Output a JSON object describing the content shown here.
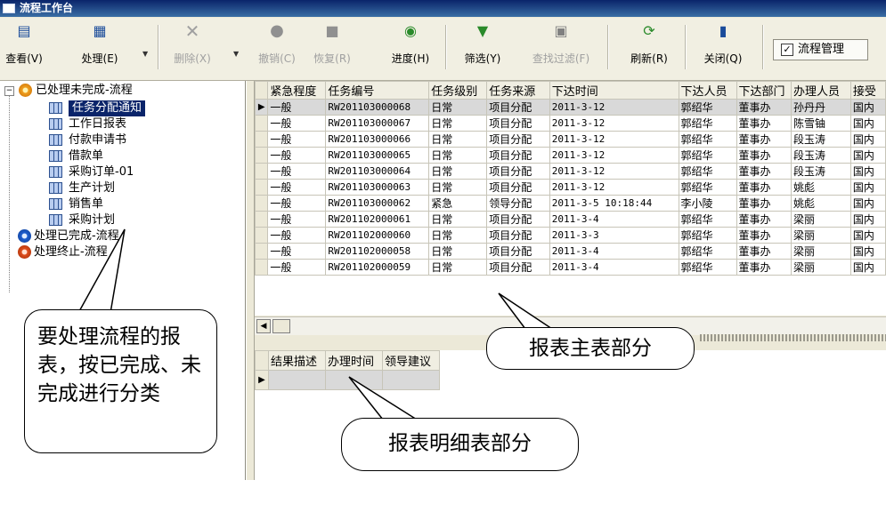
{
  "window": {
    "title": "流程工作台"
  },
  "toolbar": {
    "view": "查看(V)",
    "handle": "处理(E)",
    "delete": "删除(X)",
    "undo": "撤销(C)",
    "restore": "恢复(R)",
    "progress": "进度(H)",
    "filter": "筛选(Y)",
    "find_filter": "查找过滤(F)",
    "refresh": "刷新(R)",
    "close": "关闭(Q)",
    "flow_mgmt": "流程管理"
  },
  "tree": {
    "root_unfinished": "已处理未完成-流程",
    "children": [
      "任务分配通知",
      "工作日报表",
      "付款申请书",
      "借款单",
      "采购订单-01",
      "生产计划",
      "销售单",
      "采购计划"
    ],
    "root_finished": "处理已完成-流程",
    "root_stopped": "处理终止-流程"
  },
  "grid": {
    "columns": [
      "紧急程度",
      "任务编号",
      "任务级别",
      "任务来源",
      "下达时间",
      "下达人员",
      "下达部门",
      "办理人员",
      "接受"
    ],
    "rows": [
      [
        "一般",
        "RW201103000068",
        "日常",
        "项目分配",
        "2011-3-12",
        "郭绍华",
        "董事办",
        "孙丹丹",
        "国内"
      ],
      [
        "一般",
        "RW201103000067",
        "日常",
        "项目分配",
        "2011-3-12",
        "郭绍华",
        "董事办",
        "陈雪铀",
        "国内"
      ],
      [
        "一般",
        "RW201103000066",
        "日常",
        "项目分配",
        "2011-3-12",
        "郭绍华",
        "董事办",
        "段玉涛",
        "国内"
      ],
      [
        "一般",
        "RW201103000065",
        "日常",
        "项目分配",
        "2011-3-12",
        "郭绍华",
        "董事办",
        "段玉涛",
        "国内"
      ],
      [
        "一般",
        "RW201103000064",
        "日常",
        "项目分配",
        "2011-3-12",
        "郭绍华",
        "董事办",
        "段玉涛",
        "国内"
      ],
      [
        "一般",
        "RW201103000063",
        "日常",
        "项目分配",
        "2011-3-12",
        "郭绍华",
        "董事办",
        "姚彪",
        "国内"
      ],
      [
        "一般",
        "RW201103000062",
        "紧急",
        "领导分配",
        "2011-3-5 10:18:44",
        "李小陵",
        "董事办",
        "姚彪",
        "国内"
      ],
      [
        "一般",
        "RW201102000061",
        "日常",
        "项目分配",
        "2011-3-4",
        "郭绍华",
        "董事办",
        "梁丽",
        "国内"
      ],
      [
        "一般",
        "RW201102000060",
        "日常",
        "项目分配",
        "2011-3-3",
        "郭绍华",
        "董事办",
        "梁丽",
        "国内"
      ],
      [
        "一般",
        "RW201102000058",
        "日常",
        "项目分配",
        "2011-3-4",
        "郭绍华",
        "董事办",
        "梁丽",
        "国内"
      ],
      [
        "一般",
        "RW201102000059",
        "日常",
        "项目分配",
        "2011-3-4",
        "郭绍华",
        "董事办",
        "梁丽",
        "国内"
      ]
    ]
  },
  "detail": {
    "columns": [
      "结果描述",
      "办理时间",
      "领导建议"
    ]
  },
  "annotations": {
    "left": "要处理流程的报表，按已完成、未完成进行分类",
    "main": "报表主表部分",
    "detail": "报表明细表部分"
  },
  "colors": {
    "titlebar": "#0a246a",
    "selection": "#0a246a",
    "unfinished_icon": "#f0a020",
    "finished_icon": "#2060d0",
    "stopped_icon": "#e05020"
  }
}
